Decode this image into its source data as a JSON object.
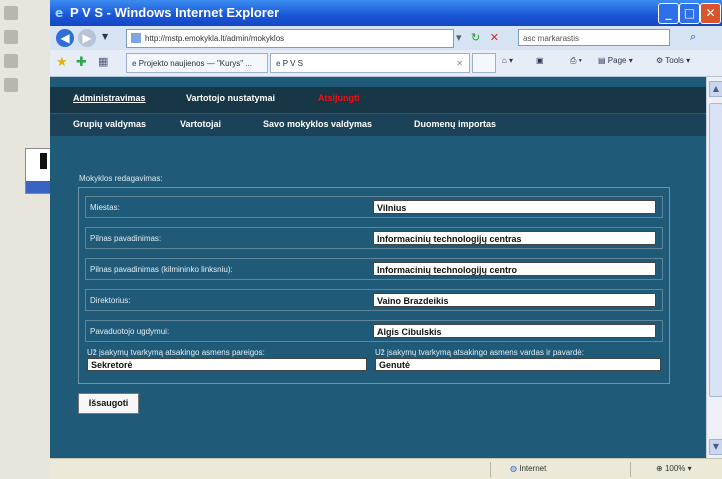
{
  "window": {
    "title": "P V S - Windows Internet Explorer"
  },
  "address_bar": {
    "url": "http://mstp.emokykla.lt/admin/mokyklos"
  },
  "search": {
    "placeholder": "asc markarastis"
  },
  "tabs": [
    {
      "label": "Projekto naujienos — \"Kurys\" ..."
    },
    {
      "label": "P V S"
    }
  ],
  "toolbar": {
    "page_label": "Page",
    "tools_label": "Tools"
  },
  "nav_main": {
    "items": [
      {
        "label": "Administravimas"
      },
      {
        "label": "Vartotojo nustatymai"
      },
      {
        "label": "Atsijungti"
      }
    ]
  },
  "nav_sub": {
    "items": [
      {
        "label": "Grupių valdymas"
      },
      {
        "label": "Vartotojai"
      },
      {
        "label": "Savo mokyklos valdymas"
      },
      {
        "label": "Duomenų importas"
      }
    ]
  },
  "form": {
    "section_title": "Mokyklos redagavimas:",
    "fields": [
      {
        "label": "Miestas:",
        "value": "Vilnius"
      },
      {
        "label": "Pilnas pavadinimas:",
        "value": "Informacinių technologijų centras"
      },
      {
        "label": "Pilnas pavadinimas (kilmininko linksniu):",
        "value": "Informacinių technologijų centro"
      },
      {
        "label": "Direktorius:",
        "value": "Vaino Brazdeikis"
      },
      {
        "label": "Pavaduotojo ugdymui:",
        "value": "Algis Cibulskis"
      }
    ],
    "responsible_position": {
      "label": "Už įsakymų tvarkymą atsakingo asmens pareigos:",
      "value": "Sekretorė"
    },
    "responsible_name": {
      "label": "Už įsakymų tvarkymą atsakingo asmens vardas ir pavardė:",
      "value": "Genutė"
    },
    "save_label": "Išsaugoti"
  },
  "status_bar": {
    "zone": "Internet",
    "zoom": "100%"
  }
}
